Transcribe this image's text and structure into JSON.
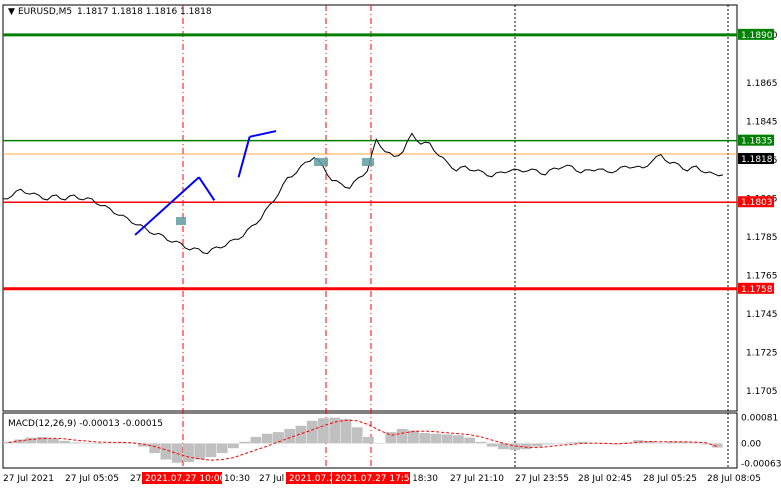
{
  "header": {
    "symbol": "EURUSD,M5",
    "ohlc": "1.1817 1.1818 1.1816 1.1818",
    "macd_label": "MACD(12,26,9) -0.00013 -0.00015"
  },
  "chart_data": [
    {
      "type": "line",
      "title": "EURUSD,M5",
      "ylim": [
        1.1695,
        1.1905
      ],
      "yticks": [
        "1.1890",
        "1.1865",
        "1.1845",
        "1.1825",
        "1.1805",
        "1.1785",
        "1.1765",
        "1.1745",
        "1.1725",
        "1.1705"
      ],
      "current_price": "1.1818",
      "hlines": [
        {
          "label": "1.1890",
          "value": 1.189,
          "color": "#008000",
          "weight": "thick"
        },
        {
          "label": "1.1835",
          "value": 1.1835,
          "color": "#008000",
          "weight": "thin"
        },
        {
          "label": "1.1803",
          "value": 1.1803,
          "color": "#ff0000",
          "weight": "thin"
        },
        {
          "label": "1.1758",
          "value": 1.1758,
          "color": "#ff0000",
          "weight": "thick"
        }
      ],
      "series": [
        {
          "values": [
            1.1804,
            1.1807,
            1.1809,
            1.1808,
            1.1806,
            1.1805,
            1.1806,
            1.1805,
            1.1806,
            1.1805,
            1.1804,
            1.1802,
            1.1799,
            1.1797,
            1.1794,
            1.1792,
            1.1789,
            1.1787,
            1.1785,
            1.1783,
            1.1781,
            1.1779,
            1.1778,
            1.1777,
            1.1779,
            1.1781,
            1.1783,
            1.1786,
            1.179,
            1.1795,
            1.1801,
            1.1808,
            1.1815,
            1.1819,
            1.1823,
            1.1827,
            1.1821,
            1.1815,
            1.1812,
            1.1811,
            1.1815,
            1.182,
            1.1835,
            1.183,
            1.1826,
            1.183,
            1.1838,
            1.1834,
            1.1833,
            1.1828,
            1.1823,
            1.182,
            1.1821,
            1.182,
            1.1818,
            1.1817,
            1.1818,
            1.182,
            1.1819,
            1.182,
            1.1819,
            1.1818,
            1.182,
            1.1822,
            1.1821,
            1.1819,
            1.1819,
            1.1821,
            1.1818,
            1.182,
            1.1821,
            1.1822,
            1.182,
            1.1825,
            1.1827,
            1.1824,
            1.1822,
            1.182,
            1.1821,
            1.1819,
            1.1817,
            1.1818
          ]
        }
      ],
      "annotations": [
        {
          "x1": "2021.07.27 10:00",
          "y1": 1.1786,
          "x2": "2021.07.27 14:50",
          "y2": 1.1816
        },
        {
          "x1": "2021.07.27 14:50",
          "y1": 1.1816,
          "x2": "2021.07.27 16:00",
          "y2": 1.1804
        },
        {
          "x1": "2021.07.27 17:50",
          "y1": 1.1816,
          "x2": "2021.07.27 18:40",
          "y2": 1.1837
        },
        {
          "x1": "2021.07.27 18:40",
          "y1": 1.1837,
          "x2": "2021.07.27 20:40",
          "y2": 1.184
        }
      ]
    },
    {
      "type": "bar",
      "title": "MACD(12,26,9)",
      "ylim": [
        -0.0007,
        0.00088
      ],
      "yticks": [
        "0.00081",
        "0.00",
        "-0.00063"
      ],
      "series": [
        {
          "name": "MACD",
          "values": [
            5e-05,
            0.00012,
            0.00018,
            0.0002,
            0.00015,
            8e-05,
            3e-05,
            1e-05,
            0.0,
            2e-05,
            3e-05,
            0.0,
            -0.0001,
            -0.0003,
            -0.0005,
            -0.0006,
            -0.00058,
            -0.0005,
            -0.00042,
            -0.0003,
            -0.00015,
            5e-05,
            0.0002,
            0.0003,
            0.00035,
            0.00045,
            0.00055,
            0.0007,
            0.00078,
            0.0008,
            0.00075,
            0.0005,
            0.0002,
            0.0,
            0.00035,
            0.00045,
            0.0004,
            0.00032,
            0.0003,
            0.00028,
            0.00025,
            0.00018,
            5e-05,
            -0.0001,
            -0.00018,
            -0.0002,
            -0.00018,
            -0.0001,
            -3e-05,
            0.0,
            3e-05,
            5e-05,
            2e-05,
            -1e-05,
            -3e-05,
            3e-05,
            0.0001,
            7e-05,
            2e-05,
            6e-05,
            6e-05,
            3e-05,
            -3e-05,
            -0.00013
          ]
        },
        {
          "name": "Signal",
          "values": [
            3e-05,
            8e-05,
            0.00012,
            0.00015,
            0.00016,
            0.00014,
            0.0001,
            7e-05,
            4e-05,
            3e-05,
            3e-05,
            2e-05,
            -2e-05,
            -0.0001,
            -0.0002,
            -0.00032,
            -0.00042,
            -0.00048,
            -0.00052,
            -0.0005,
            -0.00044,
            -0.00032,
            -0.0002,
            -8e-05,
            5e-05,
            0.00018,
            0.0003,
            0.00042,
            0.00055,
            0.00066,
            0.00072,
            0.0007,
            0.00058,
            0.0004,
            0.00025,
            0.00032,
            0.00037,
            0.00038,
            0.00036,
            0.00033,
            0.0003,
            0.00027,
            0.0002,
            0.0001,
            0.0,
            -8e-05,
            -0.00012,
            -0.00013,
            -0.0001,
            -6e-05,
            -3e-05,
            0.0,
            1e-05,
            0.0,
            -1e-05,
            0.0,
            4e-05,
            6e-05,
            5e-05,
            5e-05,
            5e-05,
            4e-05,
            2e-05,
            -0.0001
          ]
        }
      ]
    }
  ],
  "x_axis": {
    "ticks": [
      "27 Jul 2021",
      "27 Jul 05:05",
      "27",
      "27 Jul",
      "18:30",
      "27 Jul 21:10",
      "27 Jul 23:55",
      "28 Jul 02:45",
      "28 Jul 05:25",
      "28 Jul 08:05",
      "10:30"
    ],
    "highlighted": [
      "2021.07.27 10:00",
      "2021.07.2",
      "2021.07.27 17:50"
    ]
  },
  "colors": {
    "price_line": "#000000",
    "green_level": "#008000",
    "red_level": "#ff0000",
    "trend_line": "#0000ff",
    "marker": "#5f9ea0",
    "macd_hist": "#c0c0c0",
    "signal": "#ff0000",
    "current_price_bg": "#000000",
    "orange_line": "#ff8c00"
  }
}
